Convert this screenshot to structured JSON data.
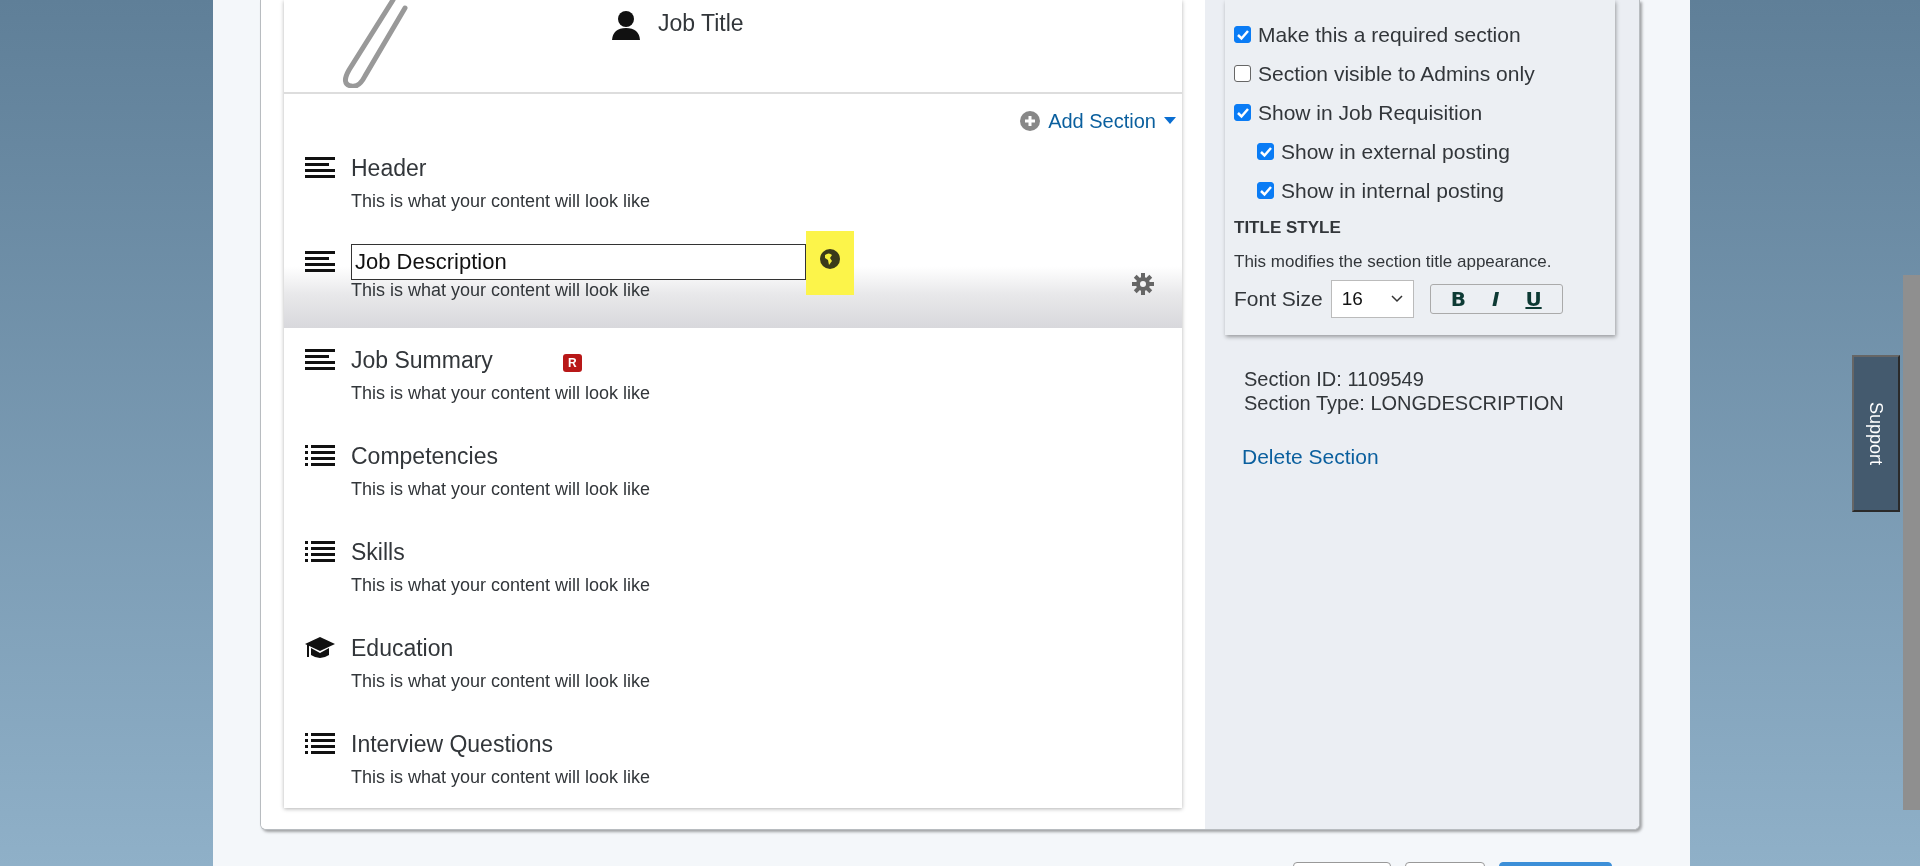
{
  "header": {
    "job_title": "Job Title"
  },
  "add_section": {
    "label": "Add Section"
  },
  "sections": [
    {
      "title": "Header",
      "description": "This is what your content will look like",
      "kind": "text",
      "selected": false
    },
    {
      "title": "Job Description",
      "description": "This is what your content will look like",
      "kind": "text",
      "selected": true
    },
    {
      "title": "Job Summary",
      "description": "This is what your content will look like",
      "kind": "text",
      "selected": false,
      "badge": "R"
    },
    {
      "title": "Competencies",
      "description": "This is what your content will look like",
      "kind": "list",
      "selected": false
    },
    {
      "title": "Skills",
      "description": "This is what your content will look like",
      "kind": "list",
      "selected": false
    },
    {
      "title": "Education",
      "description": "This is what your content will look like",
      "kind": "education",
      "selected": false
    },
    {
      "title": "Interview Questions",
      "description": "This is what your content will look like",
      "kind": "list",
      "selected": false
    }
  ],
  "settings": {
    "options": [
      {
        "label": "Make this a required section",
        "checked": true
      },
      {
        "label": "Section visible to Admins only",
        "checked": false
      },
      {
        "label": "Show in Job Requisition",
        "checked": true,
        "children": [
          {
            "label": "Show in external posting",
            "checked": true
          },
          {
            "label": "Show in internal posting",
            "checked": true
          }
        ]
      }
    ],
    "title_style": {
      "heading": "TITLE STYLE",
      "description": "This modifies the section title appearance.",
      "font_size_label": "Font Size",
      "font_size": "16",
      "bold": "B",
      "italic": "I",
      "underline": "U"
    }
  },
  "section_info": {
    "id": "Section ID: 1109549",
    "type": "Section Type: LONGDESCRIPTION",
    "delete": "Delete Section"
  },
  "support_tab": "Support"
}
